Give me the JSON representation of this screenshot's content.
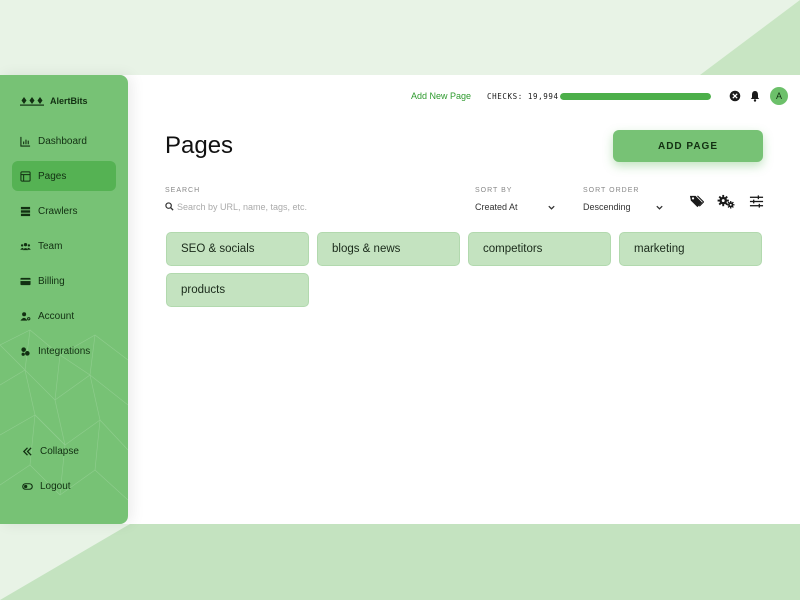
{
  "app": {
    "name": "AlertBits"
  },
  "sidebar": {
    "items": [
      {
        "label": "Dashboard",
        "icon": "chart-icon"
      },
      {
        "label": "Pages",
        "icon": "pages-icon",
        "active": true
      },
      {
        "label": "Crawlers",
        "icon": "crawler-icon"
      },
      {
        "label": "Team",
        "icon": "team-icon"
      },
      {
        "label": "Billing",
        "icon": "card-icon"
      },
      {
        "label": "Account",
        "icon": "account-icon"
      },
      {
        "label": "Integrations",
        "icon": "integrations-icon"
      }
    ],
    "bottom_items": [
      {
        "label": "Collapse",
        "icon": "double-chevron-left-icon"
      },
      {
        "label": "Logout",
        "icon": "toggle-icon"
      }
    ]
  },
  "topbar": {
    "add_new_page_link": "Add New Page",
    "checks_label": "CHECKS: 19,994",
    "checks_progress_percent": 100,
    "avatar_initial": "A"
  },
  "main": {
    "title": "Pages",
    "add_button_label": "ADD PAGE",
    "search": {
      "label": "SEARCH",
      "placeholder": "Search by URL, name, tags, etc."
    },
    "sort_by": {
      "label": "SORT BY",
      "value": "Created At"
    },
    "sort_order": {
      "label": "SORT ORDER",
      "value": "Descending"
    },
    "tags": [
      "SEO & socials",
      "blogs & news",
      "competitors",
      "marketing",
      "products"
    ]
  },
  "colors": {
    "accent": "#77c275",
    "accent_dark": "#4caf4a",
    "tag_bg": "#c4e3c0",
    "link": "#2e9a2e"
  }
}
